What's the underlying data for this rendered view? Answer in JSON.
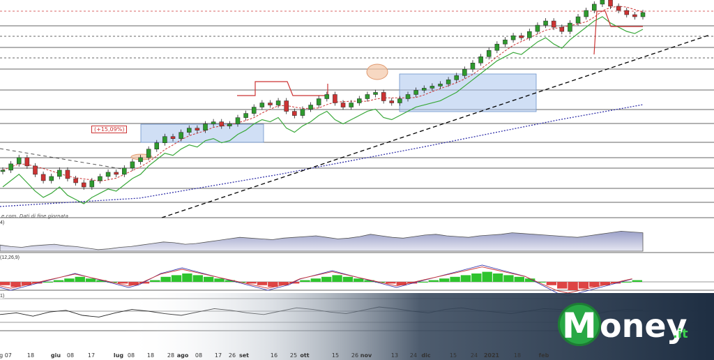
{
  "chart_data": [
    {
      "type": "line",
      "subtype": "candlestick",
      "title": "",
      "annotation_gain": "(+15,09%)",
      "footer_note": "e.com. Dati di fine giornata",
      "x_ticks": [
        "g 07",
        "18",
        "giu",
        "08",
        "17",
        "lug",
        "08",
        "18",
        "28",
        "ago",
        "08",
        "17",
        "26",
        "set",
        "16",
        "25",
        "ott",
        "15",
        "26",
        "nov",
        "13",
        "24",
        "dic",
        "15",
        "24",
        "2021",
        "18",
        "feb"
      ],
      "y_range": [
        0,
        100
      ],
      "close_series": [
        52,
        55,
        58,
        54,
        50,
        47,
        49,
        52,
        48,
        46,
        44,
        47,
        49,
        51,
        50,
        53,
        56,
        58,
        62,
        65,
        68,
        67,
        70,
        72,
        71,
        74,
        75,
        73,
        74,
        77,
        79,
        82,
        84,
        83,
        85,
        80,
        78,
        81,
        83,
        86,
        88,
        84,
        82,
        84,
        86,
        88,
        89,
        85,
        84,
        86,
        88,
        90,
        91,
        92,
        93,
        95,
        97,
        100,
        103,
        106,
        109,
        112,
        114,
        116,
        115,
        118,
        121,
        123,
        120,
        118,
        122,
        125,
        128,
        131,
        133,
        130,
        128,
        126,
        125,
        127
      ],
      "indicators": {
        "moving_average": "dashed red",
        "trailing_stop": "green / red step",
        "long_trend": "dotted blue",
        "support_trend": "dashed black"
      },
      "colors": {
        "bullish": "#2e9a2e",
        "bearish": "#cc3333",
        "box": "#aac4ec",
        "trend": "#000000",
        "blue_ma": "#3333aa"
      }
    },
    {
      "type": "area",
      "label": "4)",
      "values": [
        46,
        44,
        43,
        45,
        46,
        47,
        45,
        44,
        42,
        40,
        41,
        43,
        44,
        46,
        48,
        50,
        49,
        47,
        48,
        50,
        52,
        54,
        56,
        55,
        54,
        53,
        55,
        56,
        57,
        58,
        56,
        54,
        55,
        57,
        60,
        58,
        56,
        55,
        57,
        59,
        60,
        58,
        57,
        56,
        58,
        59,
        60,
        62,
        61,
        60,
        59,
        58,
        57,
        56,
        58,
        60,
        62,
        64,
        63,
        62
      ]
    },
    {
      "type": "bar",
      "label": "(12,26,9)",
      "values": [
        -2,
        -3,
        -2,
        -1,
        0,
        1,
        2,
        3,
        2,
        1,
        0,
        -1,
        -2,
        -1,
        1,
        3,
        4,
        5,
        4,
        3,
        2,
        1,
        0,
        -1,
        -2,
        -3,
        -2,
        -1,
        1,
        2,
        3,
        4,
        3,
        2,
        1,
        0,
        -1,
        -2,
        -1,
        0,
        1,
        2,
        3,
        4,
        5,
        6,
        5,
        4,
        3,
        2,
        0,
        -2,
        -4,
        -5,
        -4,
        -3,
        -2,
        -1,
        0,
        1
      ]
    },
    {
      "type": "line",
      "label": "1)",
      "values": [
        50,
        52,
        48,
        53,
        55,
        49,
        47,
        52,
        56,
        54,
        51,
        49,
        53,
        57,
        55,
        52,
        50,
        54,
        58,
        56,
        53,
        51,
        55,
        59,
        57,
        54,
        52,
        56,
        58,
        55,
        53,
        51,
        54,
        57,
        56,
        53,
        50,
        54,
        56,
        55
      ]
    }
  ],
  "logo": {
    "text": "oney",
    "suffix": ".it",
    "mark": "M"
  }
}
